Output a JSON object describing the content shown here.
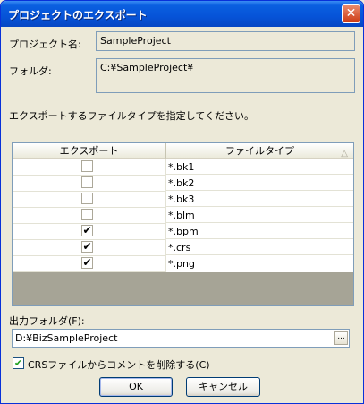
{
  "window": {
    "title": "プロジェクトのエクスポート",
    "close_glyph": "✕"
  },
  "project": {
    "name_label": "プロジェクト名:",
    "name_value": "SampleProject"
  },
  "folder": {
    "label": "フォルダ:",
    "value": "C:¥SampleProject¥"
  },
  "instruction": "エクスポートするファイルタイプを指定してください。",
  "list": {
    "headers": {
      "export": "エクスポート",
      "filetype": "ファイルタイプ",
      "sort_glyph": "△"
    },
    "rows": [
      {
        "checked": false,
        "type": "*.bk1"
      },
      {
        "checked": false,
        "type": "*.bk2"
      },
      {
        "checked": false,
        "type": "*.bk3"
      },
      {
        "checked": false,
        "type": "*.blm"
      },
      {
        "checked": true,
        "type": "*.bpm"
      },
      {
        "checked": true,
        "type": "*.crs"
      },
      {
        "checked": true,
        "type": "*.png"
      }
    ],
    "checkmark": "✔"
  },
  "output": {
    "label": "出力フォルダ(F):",
    "value": "D:¥BizSampleProject",
    "browse_glyph": "..."
  },
  "remove_comments": {
    "label": "CRSファイルからコメントを削除する(C)",
    "checked": true,
    "glyph": "✔"
  },
  "buttons": {
    "ok": "OK",
    "cancel": "キャンセル"
  }
}
